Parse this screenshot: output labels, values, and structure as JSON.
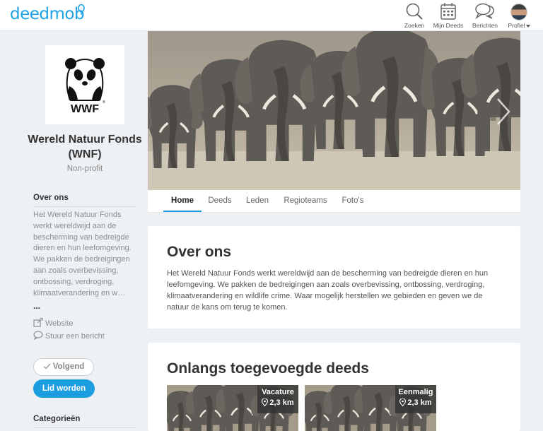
{
  "header": {
    "logo_text": "deedmob",
    "nav": [
      {
        "label": "Zoeken",
        "icon": "search-icon"
      },
      {
        "label": "Mijn Deeds",
        "icon": "calendar-icon"
      },
      {
        "label": "Berichten",
        "icon": "chat-icon"
      },
      {
        "label": "Profiel",
        "icon": "avatar"
      }
    ]
  },
  "org": {
    "logo_text": "WWF",
    "logo_mark": "®",
    "name": "Wereld Natuur Fonds (WNF)",
    "type": "Non-profit"
  },
  "sidebar": {
    "about_heading": "Over ons",
    "about_text": "Het Wereld Natuur Fonds werkt wereldwijd aan de bescherming van bedreigde dieren en hun leefomgeving. We pakken de bedreigingen aan zoals overbevissing, ontbossing, verdroging, klimaatverandering en w…",
    "more": "...",
    "website_label": "Website",
    "message_label": "Stuur een bericht",
    "follow_label": "Volgend",
    "join_label": "Lid worden",
    "categories_heading": "Categorieën"
  },
  "tabs": [
    {
      "label": "Home",
      "active": true
    },
    {
      "label": "Deeds",
      "active": false
    },
    {
      "label": "Leden",
      "active": false
    },
    {
      "label": "Regioteams",
      "active": false
    },
    {
      "label": "Foto's",
      "active": false
    }
  ],
  "about_card": {
    "title": "Over ons",
    "body": "Het Wereld Natuur Fonds werkt wereldwijd aan de bescherming van bedreigde dieren en hun leefomgeving. We pakken de bedreigingen aan zoals overbevissing, ontbossing, verdroging, klimaatverandering en wildlife crime. Waar mogelijk herstellen we gebieden en geven we de natuur de kans om terug te komen."
  },
  "recent_card": {
    "title": "Onlangs toegevoegde deeds",
    "deeds": [
      {
        "type": "Vacature",
        "distance": "2,3 km"
      },
      {
        "type": "Eenmalig",
        "distance": "2,3 km"
      }
    ]
  },
  "colors": {
    "brand": "#1da1e2",
    "button": "#1b9de0",
    "background": "#eef1f4"
  }
}
